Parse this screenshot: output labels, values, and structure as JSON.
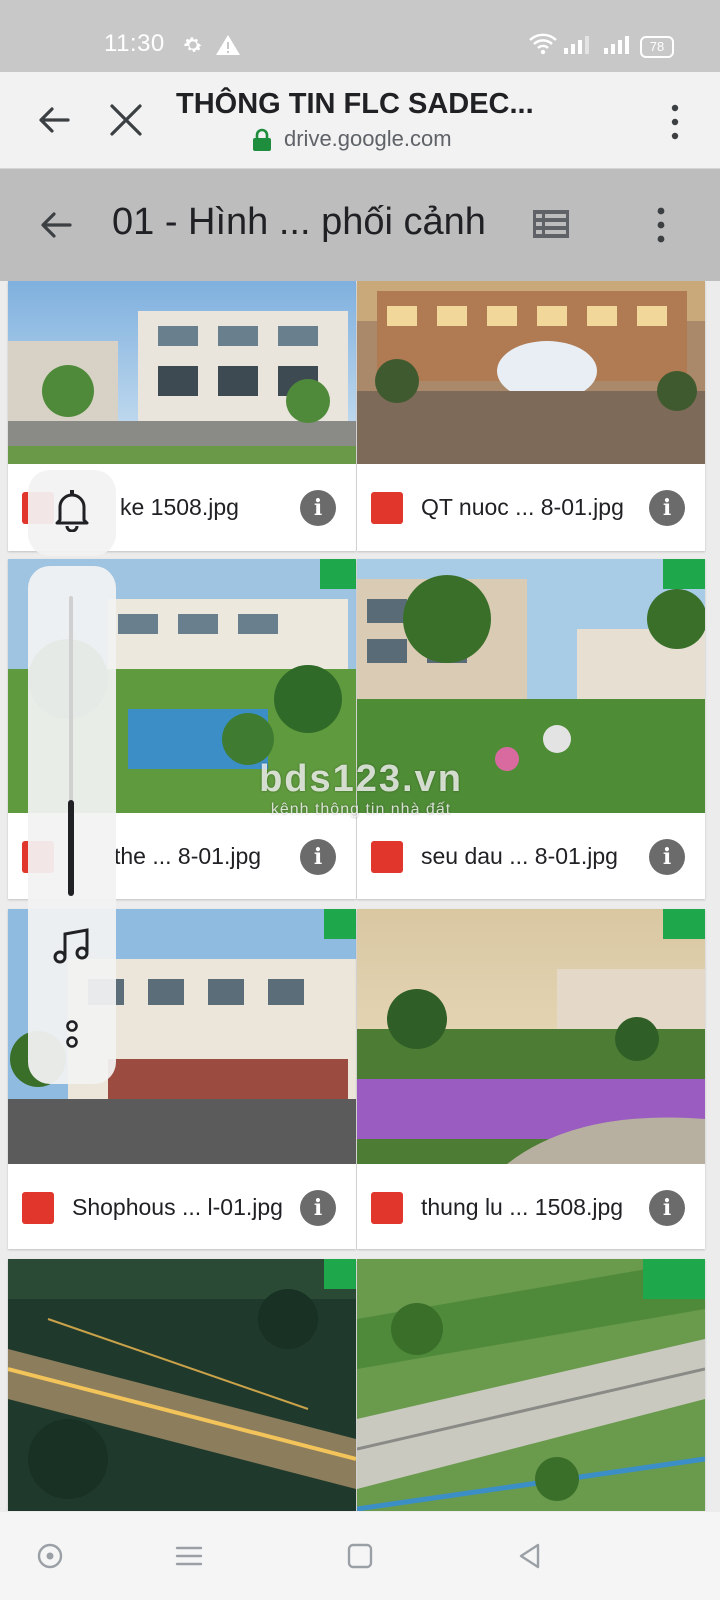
{
  "status": {
    "time": "11:30",
    "battery": "78"
  },
  "browser": {
    "title": "THÔNG TIN FLC SADEC...",
    "url": "drive.google.com",
    "icons": [
      "back-arrow-icon",
      "close-icon",
      "lock-icon",
      "more-vert-icon"
    ]
  },
  "folder": {
    "title": "01 - Hình ... phối cảnh",
    "icons": [
      "back-arrow-icon",
      "list-view-icon",
      "more-vert-icon"
    ]
  },
  "files": [
    {
      "name": "ke 1508.jpg",
      "info": "i"
    },
    {
      "name": "QT nuoc ... 8-01.jpg",
      "info": "i"
    },
    {
      "name": "the ... 8-01.jpg",
      "info": "i"
    },
    {
      "name": "seu dau ... 8-01.jpg",
      "info": "i"
    },
    {
      "name": "Shophous ... l-01.jpg",
      "info": "i"
    },
    {
      "name": "thung lu ... 1508.jpg",
      "info": "i"
    },
    {
      "name": "",
      "info": ""
    },
    {
      "name": "",
      "info": ""
    }
  ],
  "watermark": {
    "line1": "bds123.vn",
    "line2": "kênh thông tin nhà đất"
  },
  "volume": {
    "level": 0.32,
    "icons": [
      "bell-icon",
      "music-note-icon",
      "more-dots-icon"
    ]
  },
  "colors": {
    "accent": "#1fa84b",
    "file_icon": "#e0362c",
    "lock": "#1e8e3e"
  }
}
